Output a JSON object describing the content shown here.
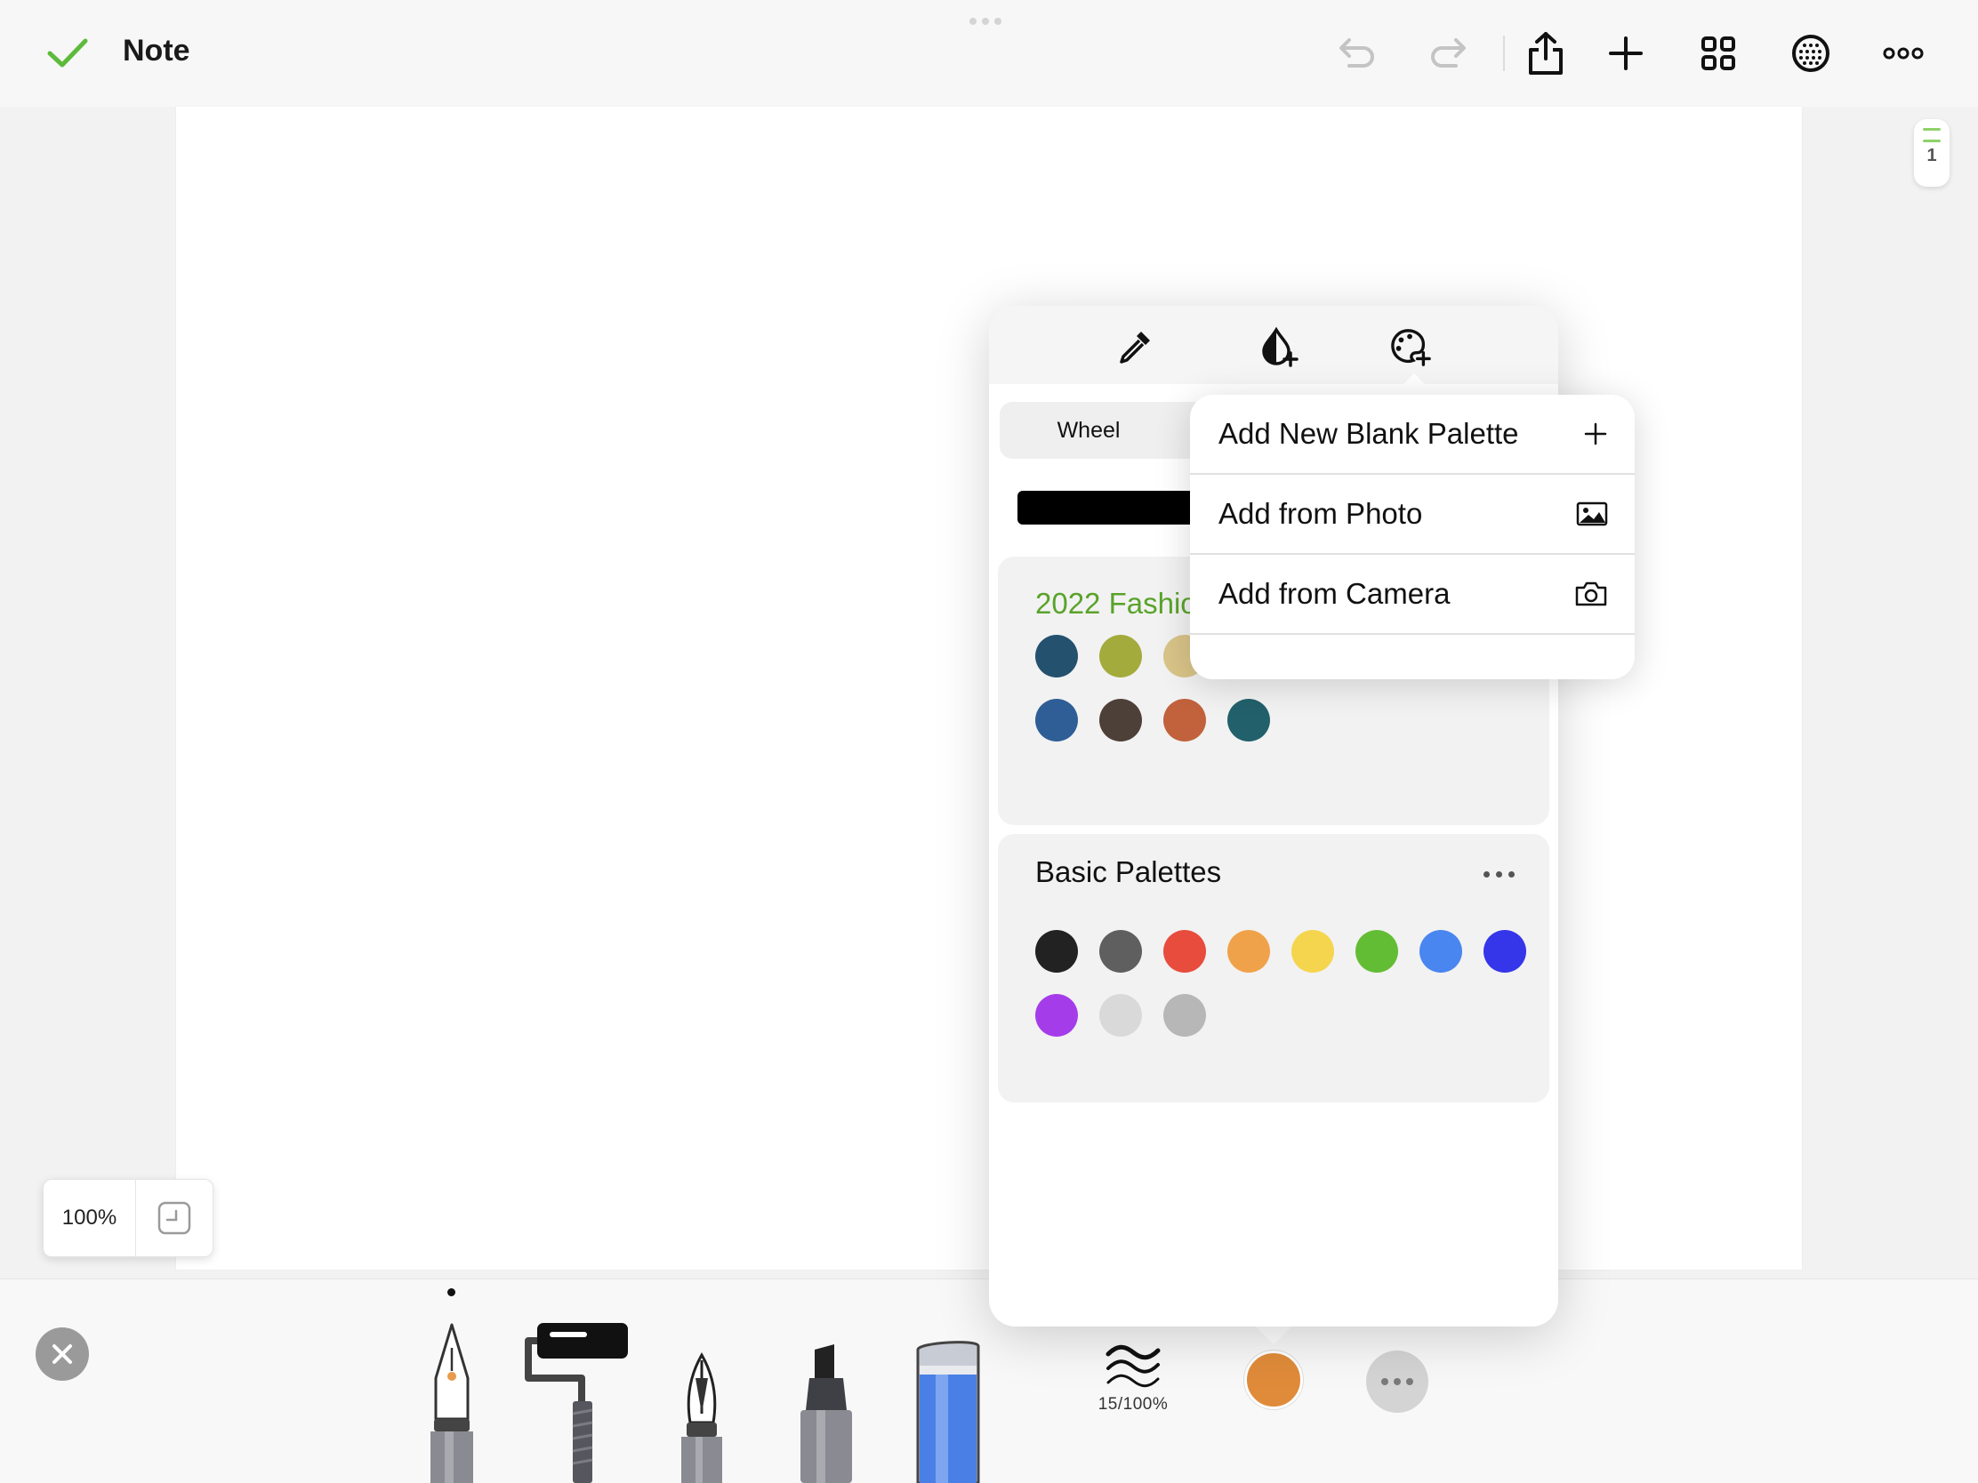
{
  "topbar": {
    "title": "Note",
    "icons": [
      "checkmark-icon",
      "undo-icon",
      "redo-icon",
      "share-icon",
      "plus-icon",
      "grid-icon",
      "globe-icon",
      "more-icon"
    ]
  },
  "page_indicator": {
    "number": "1"
  },
  "zoom": {
    "value": "100%"
  },
  "color_popover": {
    "head_icons": [
      "eyedropper-icon",
      "add-drop-icon",
      "add-palette-icon"
    ],
    "segment": {
      "active": "Wheel"
    },
    "current_color": "#000000",
    "palettes": [
      {
        "title": "2022 Fashion",
        "title_color": "#5aa32a",
        "colors": [
          "#24516e",
          "#a3ab3c",
          "#d9c488",
          "#ebc3c3",
          "#e08e40",
          "#6e3269",
          "#72a89b",
          "#a3a5a7",
          "#2f5e97",
          "#4d4039",
          "#c1623d",
          "#22606b"
        ]
      },
      {
        "title": "Basic Palettes",
        "title_color": "#111111",
        "colors": [
          "#222222",
          "#5f5f5f",
          "#e84c3d",
          "#f0a24b",
          "#f5d54e",
          "#63bd34",
          "#4a86f0",
          "#3535ea",
          "#a53cea",
          "#d9d9d9",
          "#b7b7b7"
        ]
      }
    ]
  },
  "add_menu": {
    "items": [
      {
        "label": "Add New Blank Palette",
        "icon": "plus-icon"
      },
      {
        "label": "Add from Photo",
        "icon": "photo-icon"
      },
      {
        "label": "Add from Camera",
        "icon": "camera-icon"
      }
    ]
  },
  "bottom_toolbar": {
    "tools": [
      "fountain-pen",
      "roller",
      "brush-pen",
      "marker",
      "eraser"
    ],
    "stroke": "15/100%",
    "current_color": "#e08b3a"
  }
}
